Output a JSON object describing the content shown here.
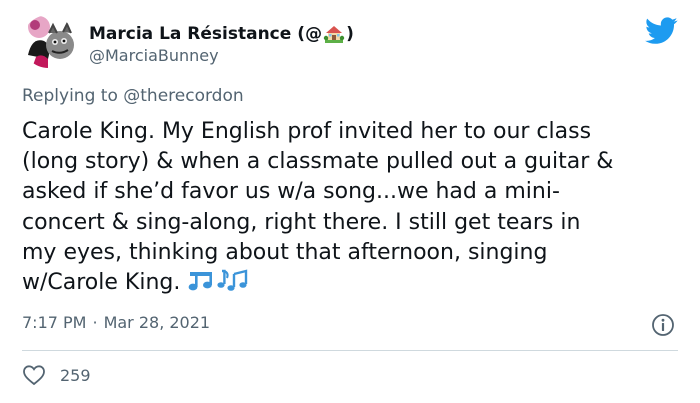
{
  "author": {
    "display_name": "Marcia La Résistance",
    "name_open": "(@",
    "name_close": ")",
    "name_emoji": "house-with-garden-icon",
    "handle": "@MarciaBunney",
    "avatar": "profile-avatar"
  },
  "brand_icon": "twitter-bird-icon",
  "reply": {
    "prefix": "Replying to",
    "handle": "@therecordon"
  },
  "body_lines": [
    "Carole King. My English prof invited her to our class",
    "(long story) & when a classmate pulled out a guitar &",
    "asked if she’d favor us w/a song...we had a mini-",
    "concert & sing-along, right there. I still get tears in",
    "my eyes, thinking about that afternoon, singing",
    "w/Carole King."
  ],
  "body_emoji": [
    "musical-note-icon",
    "musical-notes-icon"
  ],
  "meta": {
    "time": "7:17 PM",
    "separator": "·",
    "date": "Mar 28, 2021"
  },
  "info_icon": "info-icon",
  "likes": {
    "icon": "heart-icon",
    "count": "259"
  },
  "colors": {
    "text": "#0f1419",
    "secondary": "#536471",
    "twitter_blue": "#1d9bf0",
    "divider": "#cfd9de"
  }
}
